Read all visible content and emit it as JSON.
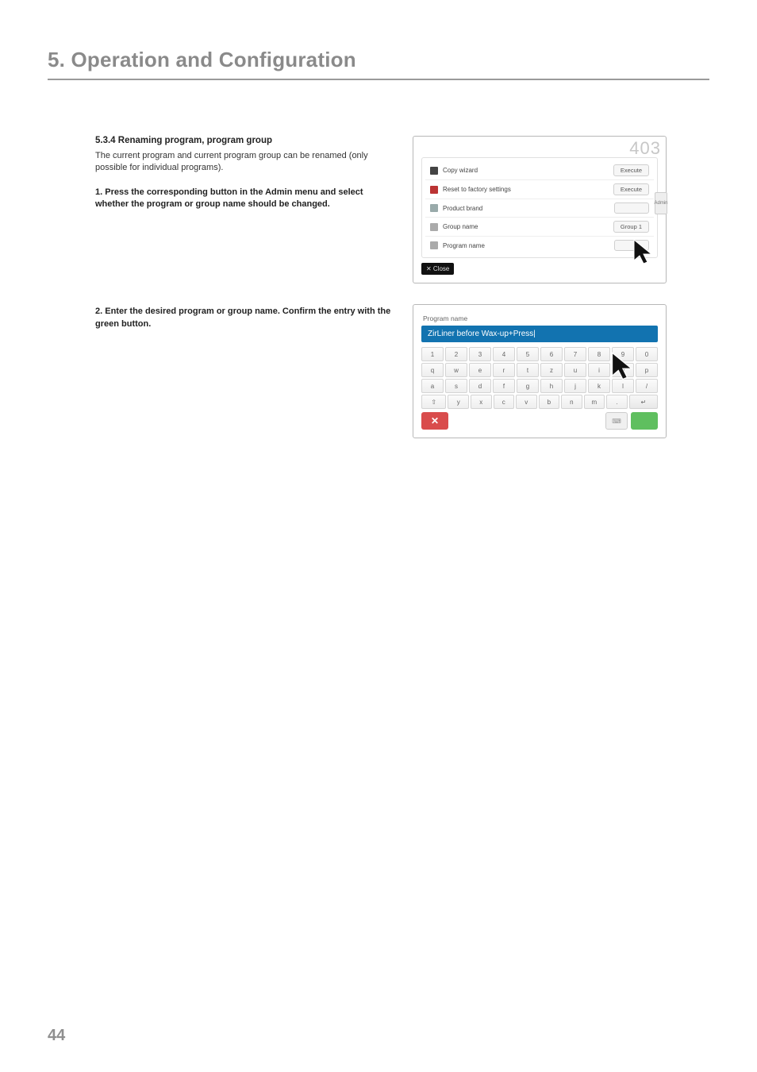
{
  "chapter_title": "5. Operation and Configuration",
  "section": {
    "number_title": "5.3.4  Renaming program, program group",
    "intro": "The current program and current program group can be renamed (only possible for individual programs).",
    "step1": "1. Press the corresponding button in the Admin menu and select whether the program or group name should be changed.",
    "step2": "2. Enter the desired program or group name. Confirm the entry with the green button."
  },
  "fig1": {
    "badge": "403",
    "rows": {
      "copy": {
        "label": "Copy wizard",
        "btn": "Execute"
      },
      "reset": {
        "label": "Reset to factory settings",
        "btn": "Execute"
      },
      "brand": {
        "label": "Product brand",
        "btn": ""
      },
      "group": {
        "label": "Group name",
        "btn": "Group 1"
      },
      "program": {
        "label": "Program name",
        "btn": ""
      }
    },
    "side_btn": "Admin",
    "close": "✕ Close"
  },
  "fig2": {
    "header": "Program name",
    "input_value": "ZirLiner before Wax-up+Press|",
    "rows": [
      [
        "1",
        "2",
        "3",
        "4",
        "5",
        "6",
        "7",
        "8",
        "9",
        "0"
      ],
      [
        "q",
        "w",
        "e",
        "r",
        "t",
        "z",
        "u",
        "i",
        "o",
        "p"
      ],
      [
        "a",
        "s",
        "d",
        "f",
        "g",
        "h",
        "j",
        "k",
        "l",
        "/"
      ],
      [
        "⇧",
        "y",
        "x",
        "c",
        "v",
        "b",
        "n",
        "m",
        ".",
        "↵"
      ]
    ],
    "cancel": "✕",
    "kbtoggle": "⌨"
  },
  "page_number": "44"
}
